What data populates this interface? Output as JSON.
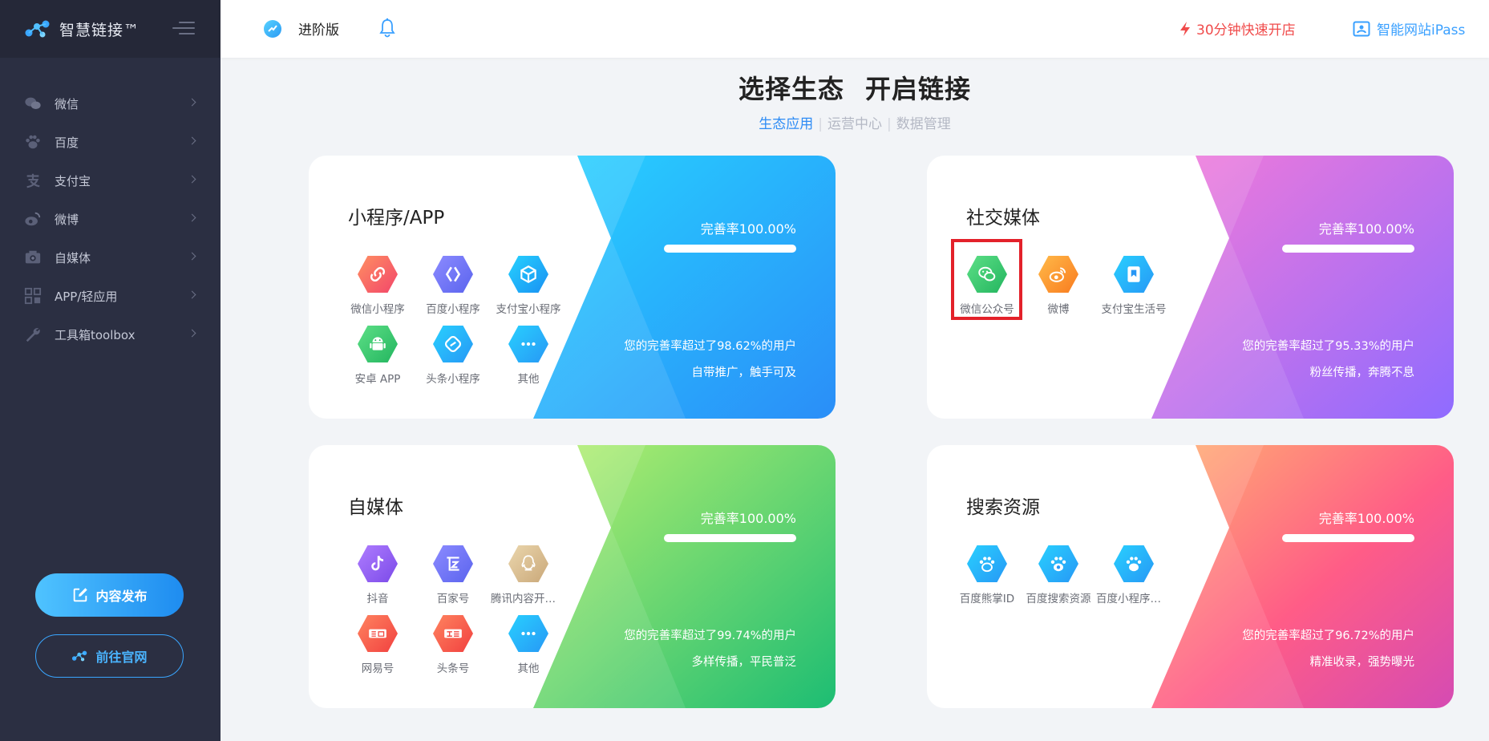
{
  "sidebar": {
    "brand": "智慧链接™",
    "items": [
      {
        "label": "微信",
        "icon": "wechat-icon"
      },
      {
        "label": "百度",
        "icon": "paw-icon"
      },
      {
        "label": "支付宝",
        "icon": "alipay-icon"
      },
      {
        "label": "微博",
        "icon": "weibo-icon"
      },
      {
        "label": "自媒体",
        "icon": "camera-icon"
      },
      {
        "label": "APP/轻应用",
        "icon": "grid-icon"
      },
      {
        "label": "工具箱toolbox",
        "icon": "wrench-icon"
      }
    ],
    "publish_label": "内容发布",
    "official_label": "前往官网"
  },
  "topbar": {
    "version": "进阶版",
    "fast_open": "30分钟快速开店",
    "smart_site": "智能网站iPass"
  },
  "main": {
    "title_left": "选择生态",
    "title_right": "开启链接",
    "subnav": [
      "生态应用",
      "运营中心",
      "数据管理"
    ]
  },
  "cards": [
    {
      "title": "小程序/APP",
      "rate": "完善率100.00%",
      "progress": 1.0,
      "beat": "您的完善率超过了98.62%的用户",
      "slogan": "自带推广，触手可及",
      "colors": [
        "#27d3ff",
        "#2a8ef8"
      ],
      "apps": [
        {
          "name": "微信小程序",
          "icon": "link-icon",
          "color": "g-red"
        },
        {
          "name": "百度小程序",
          "icon": "chevrons-icon",
          "color": "g-purple"
        },
        {
          "name": "支付宝小程序",
          "icon": "cube-icon",
          "color": "g-blue"
        },
        {
          "name": "安卓 APP",
          "icon": "android-icon",
          "color": "g-green"
        },
        {
          "name": "头条小程序",
          "icon": "swirl-icon",
          "color": "g-cyan"
        },
        {
          "name": "其他",
          "icon": "more-icon",
          "color": "g-cyan"
        }
      ]
    },
    {
      "title": "社交媒体",
      "rate": "完善率100.00%",
      "progress": 1.0,
      "beat": "您的完善率超过了95.33%的用户",
      "slogan": "粉丝传播，奔腾不息",
      "colors": [
        "#f47ad8",
        "#8f6bff"
      ],
      "apps": [
        {
          "name": "微信公众号",
          "icon": "wechat-icon",
          "color": "g-green"
        },
        {
          "name": "微博",
          "icon": "weibo-icon",
          "color": "g-orange"
        },
        {
          "name": "支付宝生活号",
          "icon": "bookmark-icon",
          "color": "g-cyan"
        }
      ]
    },
    {
      "title": "自媒体",
      "rate": "完善率100.00%",
      "progress": 1.0,
      "beat": "您的完善率超过了99.74%的用户",
      "slogan": "多样传播，平民普泛",
      "colors": [
        "#b9f06f",
        "#1dbd73"
      ],
      "apps": [
        {
          "name": "抖音",
          "icon": "tiktok-icon",
          "color": "g-violet"
        },
        {
          "name": "百家号",
          "icon": "baijia-icon",
          "color": "g-purple"
        },
        {
          "name": "腾讯内容开放平台",
          "icon": "qq-icon",
          "color": "g-tan"
        },
        {
          "name": "网易号",
          "icon": "netease-icon",
          "color": "g-tomato"
        },
        {
          "name": "头条号",
          "icon": "toutiao-icon",
          "color": "g-tomato"
        },
        {
          "name": "其他",
          "icon": "more-icon",
          "color": "g-cyan"
        }
      ]
    },
    {
      "title": "搜索资源",
      "rate": "完善率100.00%",
      "progress": 1.0,
      "beat": "您的完善率超过了96.72%的用户",
      "slogan": "精准收录，强势曝光",
      "colors": [
        "#ffb271",
        "#e94b9b"
      ],
      "apps": [
        {
          "name": "百度熊掌ID",
          "icon": "paw-icon",
          "color": "g-cyan"
        },
        {
          "name": "百度搜索资源",
          "icon": "paw-icon",
          "color": "g-cyan"
        },
        {
          "name": "百度小程序搜索",
          "icon": "paw-icon",
          "color": "g-cyan"
        }
      ]
    }
  ]
}
